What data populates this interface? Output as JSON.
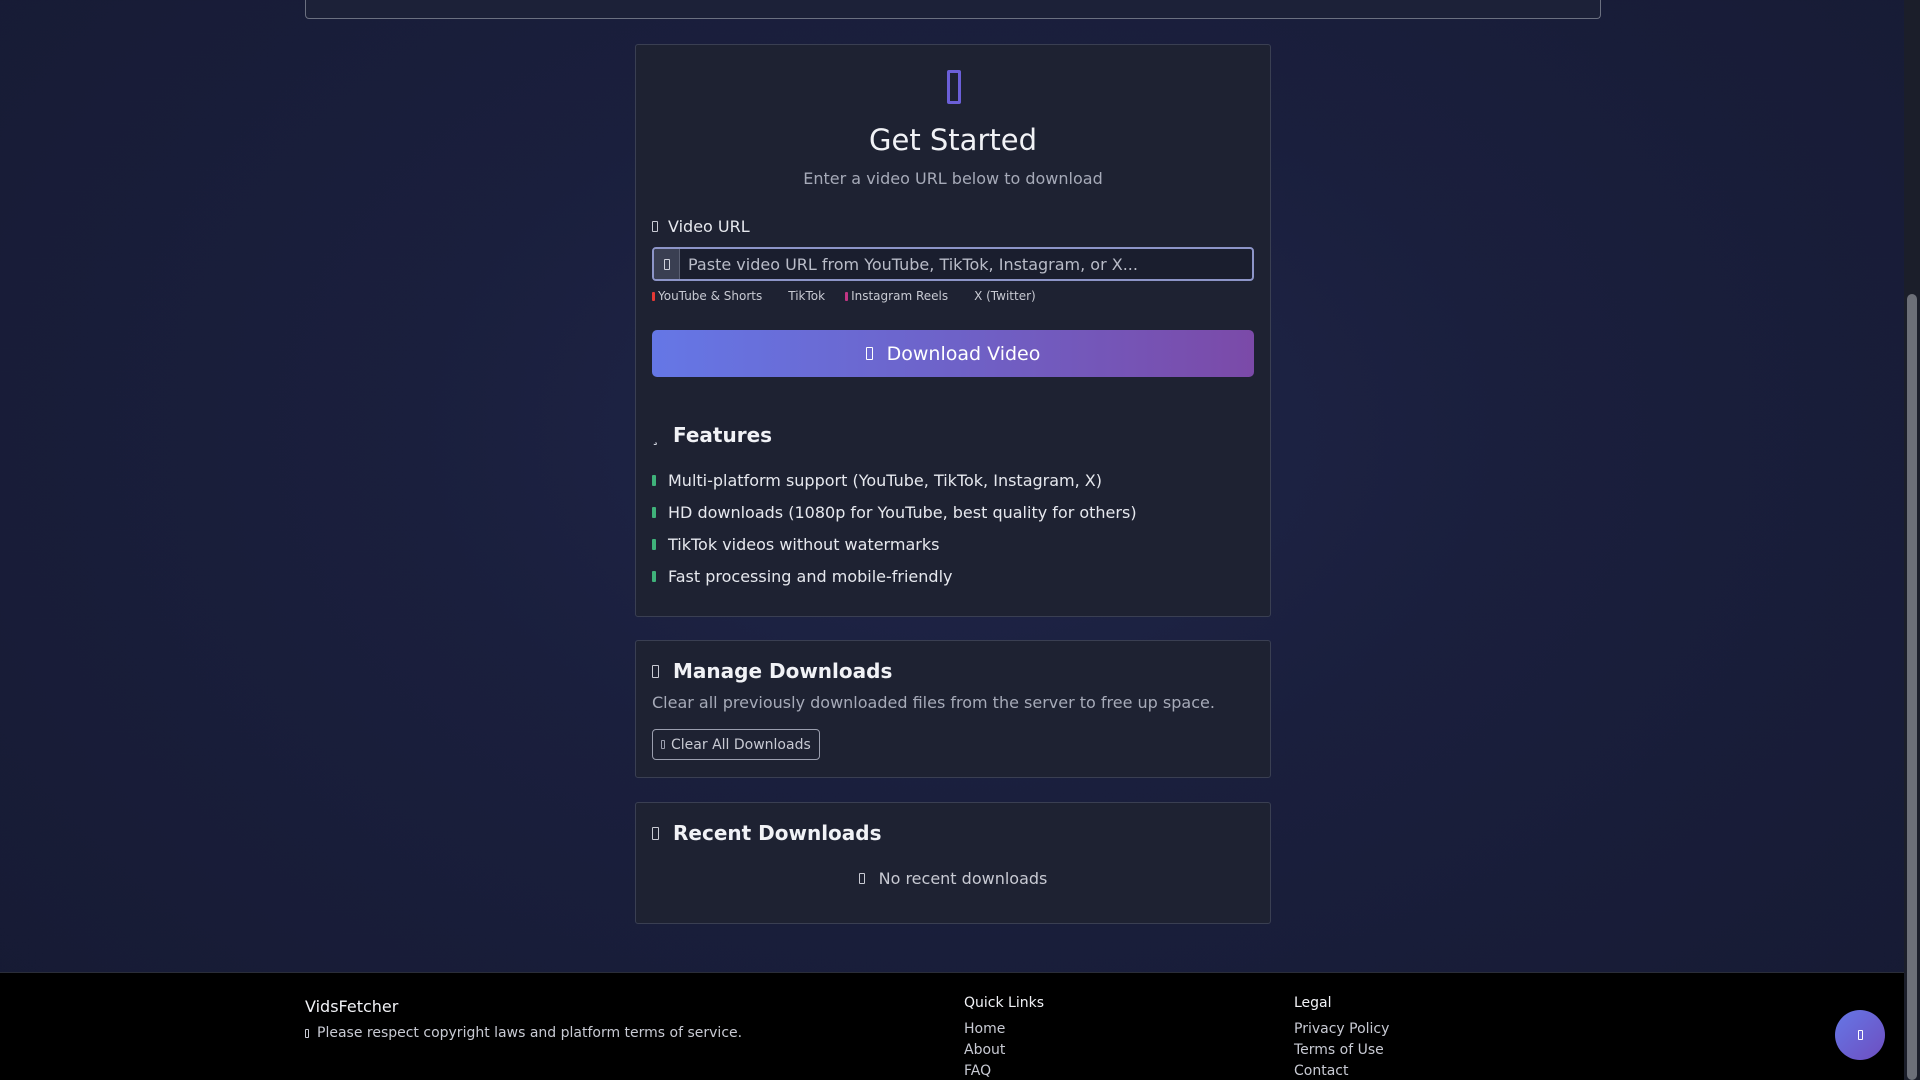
{
  "main_card": {
    "hero_icon": "video-icon",
    "title": "Get Started",
    "subtitle": "Enter a video URL below to download",
    "field_label": "Video URL",
    "url_input": {
      "value": "",
      "placeholder": "Paste video URL from YouTube, TikTok, Instagram, or X..."
    },
    "platforms": [
      {
        "label": "YouTube & Shorts",
        "color": "#e53935"
      },
      {
        "label": "TikTok",
        "color": ""
      },
      {
        "label": "Instagram Reels",
        "color": "#c13584"
      },
      {
        "label": "X (Twitter)",
        "color": ""
      }
    ],
    "download_label": "Download Video",
    "features_title": "Features",
    "features": [
      "Multi-platform support (YouTube, TikTok, Instagram, X)",
      "HD downloads (1080p for YouTube, best quality for others)",
      "TikTok videos without watermarks",
      "Fast processing and mobile-friendly"
    ]
  },
  "manage": {
    "title": "Manage Downloads",
    "description": "Clear all previously downloaded files from the server to free up space.",
    "clear_label": "Clear All Downloads"
  },
  "recent": {
    "title": "Recent Downloads",
    "empty_text": "No recent downloads"
  },
  "footer": {
    "brand": "VidsFetcher",
    "note": "Please respect copyright laws and platform terms of service.",
    "quick_links_title": "Quick Links",
    "quick_links": [
      "Home",
      "About",
      "FAQ"
    ],
    "legal_title": "Legal",
    "legal_links": [
      "Privacy Policy",
      "Terms of Use",
      "Contact"
    ]
  },
  "colors": {
    "accent_start": "#6577e6",
    "accent_end": "#7b4aa8",
    "check_green": "#3fb27a"
  }
}
